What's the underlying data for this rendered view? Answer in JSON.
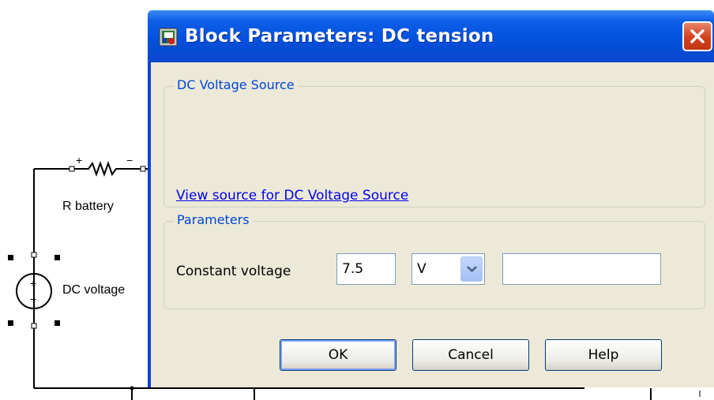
{
  "schematic": {
    "resistor_label": "R battery",
    "source_label": "DC voltage"
  },
  "dialog": {
    "title": "Block Parameters: DC tension",
    "source_group": {
      "legend": "DC Voltage Source",
      "link_text": "View source for DC Voltage Source"
    },
    "parameters_group": {
      "legend": "Parameters",
      "param_label": "Constant voltage",
      "voltage_value": "7.5",
      "unit_value": "V",
      "extra_value": ""
    },
    "buttons": {
      "ok": "OK",
      "cancel": "Cancel",
      "help": "Help"
    }
  },
  "colors": {
    "titlebar": "#0451dd",
    "client_bg": "#ece9d8",
    "link": "#0000ee",
    "legend": "#0046d5",
    "close": "#d2401c"
  },
  "icons": [
    "app-block-icon",
    "close-icon",
    "dropdown-arrow-icon"
  ]
}
